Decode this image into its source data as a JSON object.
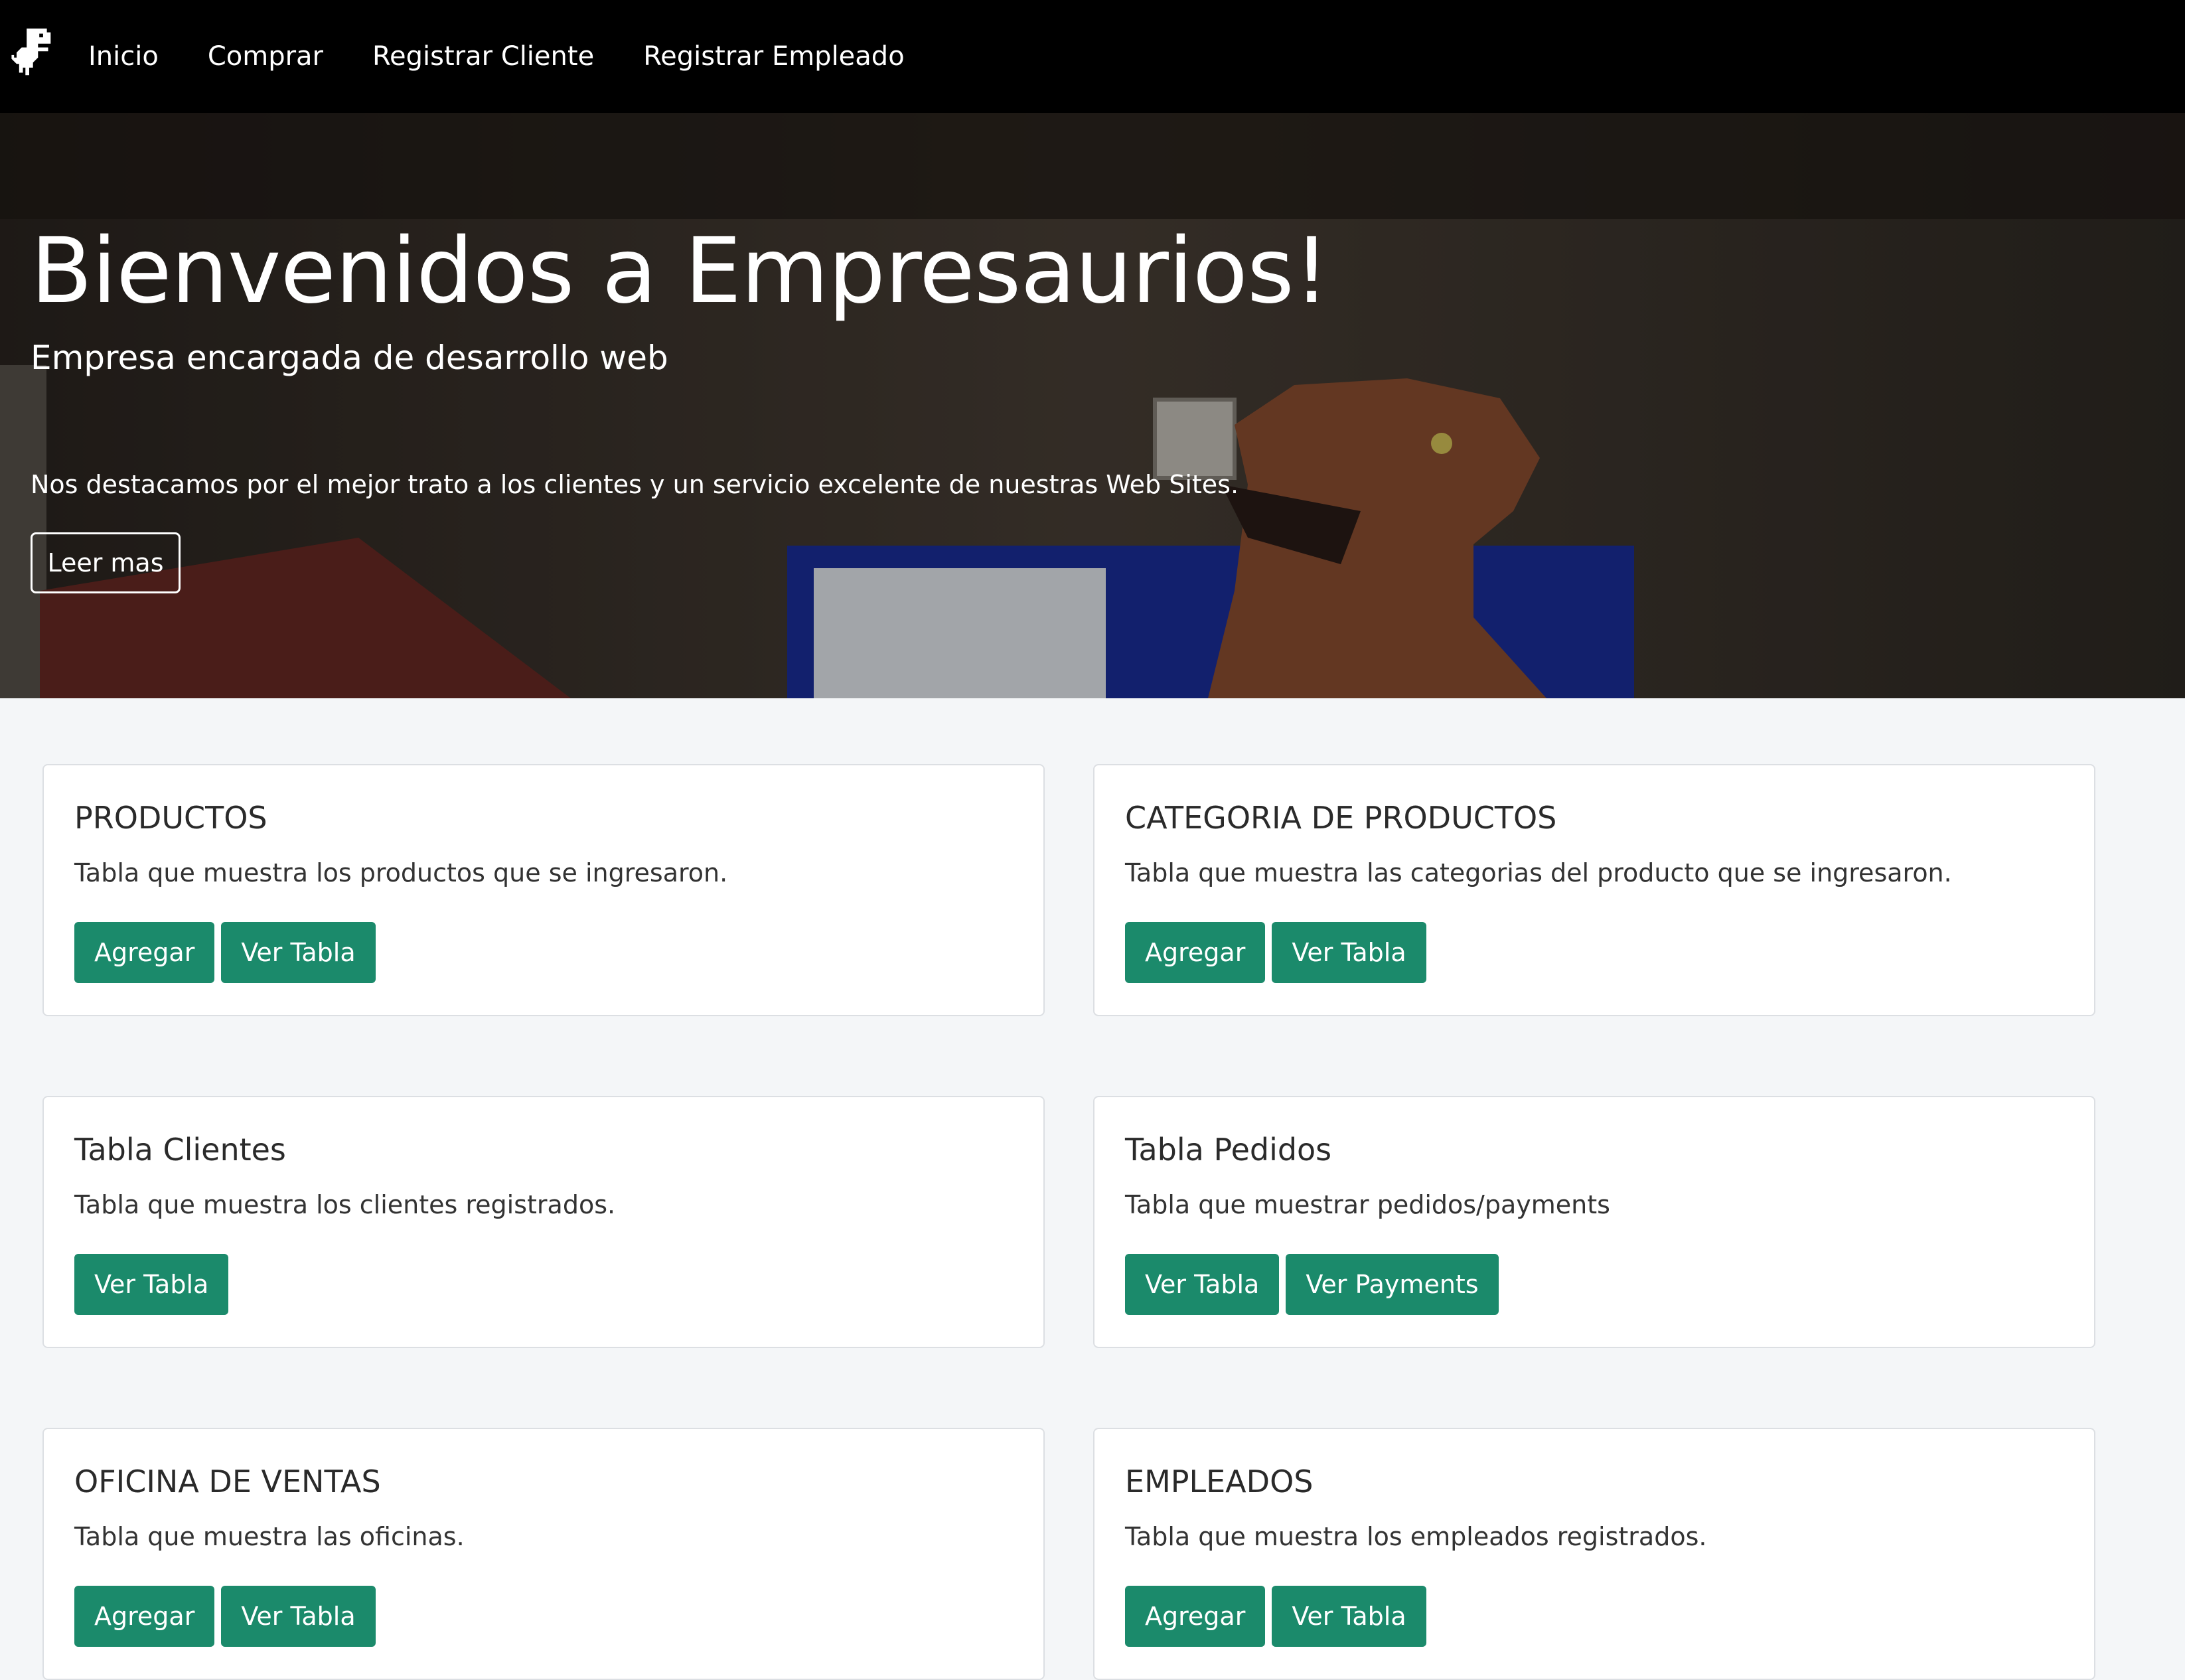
{
  "nav": {
    "logo_icon": "dinosaur-icon",
    "links": [
      "Inicio",
      "Comprar",
      "Registrar Cliente",
      "Registrar Empleado"
    ]
  },
  "hero": {
    "title": "Bienvenidos a Empresaurios!",
    "subtitle": "Empresa encargada de desarrollo web",
    "text": "Nos destacamos por el mejor trato a los clientes y un servicio excelente de nuestras Web Sites.",
    "button": "Leer mas"
  },
  "cards": [
    {
      "title": "PRODUCTOS",
      "text": "Tabla que muestra los productos que se ingresaron.",
      "buttons": [
        "Agregar",
        "Ver Tabla"
      ]
    },
    {
      "title": "CATEGORIA DE PRODUCTOS",
      "text": "Tabla que muestra las categorias del producto que se ingresaron.",
      "buttons": [
        "Agregar",
        "Ver Tabla"
      ]
    },
    {
      "title": "Tabla Clientes",
      "text": "Tabla que muestra los clientes registrados.",
      "buttons": [
        "Ver Tabla"
      ]
    },
    {
      "title": "Tabla Pedidos",
      "text": "Tabla que muestrar pedidos/payments",
      "buttons": [
        "Ver Tabla",
        "Ver Payments"
      ]
    },
    {
      "title": "OFICINA DE VENTAS",
      "text": "Tabla que muestra las oficinas.",
      "buttons": [
        "Agregar",
        "Ver Tabla"
      ]
    },
    {
      "title": "EMPLEADOS",
      "text": "Tabla que muestra los empleados registrados.",
      "buttons": [
        "Agregar",
        "Ver Tabla"
      ]
    }
  ],
  "colors": {
    "navbar": "#000000",
    "button": "#1b8a6b",
    "page_background": "#f4f6f8"
  }
}
